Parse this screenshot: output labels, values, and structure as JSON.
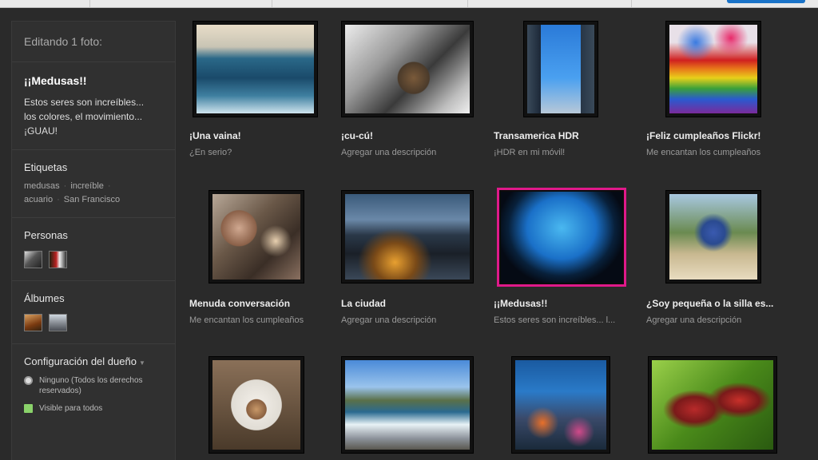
{
  "sidebar": {
    "header": "Editando 1 foto:",
    "photo_title": "¡¡Medusas!!",
    "photo_description_lines": [
      "Estos seres son increíbles...",
      "los colores, el movimiento...",
      "¡GUAU!"
    ],
    "tags_label": "Etiquetas",
    "tags": [
      "medusas",
      "increíble",
      "acuario",
      "San Francisco"
    ],
    "people_label": "Personas",
    "albums_label": "Álbumes",
    "owner_settings_label": "Configuración del dueño",
    "license_option": "Ninguno (Todos los derechos reservados)",
    "visibility_option": "Visible para todos"
  },
  "photos": [
    {
      "title": "¡Una vaina!",
      "description": "¿En serio?"
    },
    {
      "title": "¡cu-cú!",
      "description": "Agregar una descripción"
    },
    {
      "title": "Transamerica HDR",
      "description": "¡HDR en mi móvil!"
    },
    {
      "title": "¡Feliz cumpleaños Flickr!",
      "description": "Me encantan los cumpleaños"
    },
    {
      "title": "Menuda conversación",
      "description": "Me encantan los cumpleaños"
    },
    {
      "title": "La ciudad",
      "description": "Agregar una descripción"
    },
    {
      "title": "¡¡Medusas!!",
      "description": "Estos seres son increíbles... l..."
    },
    {
      "title": "¿Soy pequeña o la silla es...",
      "description": "Agregar una descripción"
    },
    {
      "title": "",
      "description": ""
    },
    {
      "title": "",
      "description": ""
    },
    {
      "title": "",
      "description": ""
    },
    {
      "title": "",
      "description": ""
    }
  ],
  "colors": {
    "selection": "#e0198a",
    "background": "#2a2a2a",
    "panel": "#303030"
  }
}
